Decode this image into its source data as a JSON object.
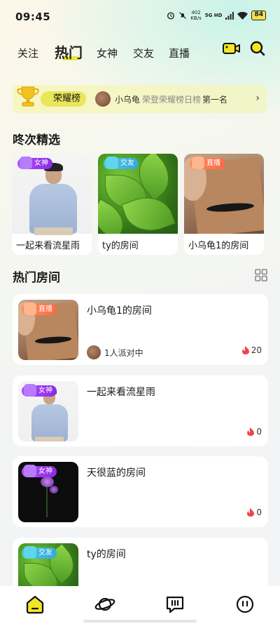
{
  "status_bar": {
    "time": "09:45",
    "speed_value": "402",
    "speed_unit": "KB/s",
    "network": "5G HD",
    "battery": "84"
  },
  "top_nav": {
    "tabs": [
      "关注",
      "热门",
      "女神",
      "交友",
      "直播"
    ],
    "active_index": 1,
    "icons": [
      "video-camera-icon",
      "search-icon"
    ]
  },
  "honor_banner": {
    "label": "荣耀榜",
    "name": "小乌龟",
    "desc": "荣登荣耀榜日榜",
    "rank": "第一名",
    "icon": "trophy-icon"
  },
  "picks": {
    "title": "咚次精选",
    "items": [
      {
        "tag": "女神",
        "tag_type": "goddess",
        "label": "一起来看流星雨",
        "image": "man-portrait"
      },
      {
        "tag": "交友",
        "tag_type": "friend",
        "label": "ty的房间",
        "image": "green-leaves"
      },
      {
        "tag": "直播",
        "tag_type": "live",
        "label": "小乌龟1的房间",
        "image": "book-cover"
      }
    ]
  },
  "hot_rooms": {
    "title": "热门房间",
    "rooms": [
      {
        "title": "小乌龟1的房间",
        "tag": "直播",
        "tag_type": "live",
        "people": "1人派对中",
        "heat": "20",
        "image": "book-cover"
      },
      {
        "title": "一起来看流星雨",
        "tag": "女神",
        "tag_type": "goddess",
        "people": "",
        "heat": "0",
        "image": "man-portrait"
      },
      {
        "title": "天很蓝的房间",
        "tag": "女神",
        "tag_type": "goddess",
        "people": "",
        "heat": "0",
        "image": "dark-flower"
      },
      {
        "title": "ty的房间",
        "tag": "交友",
        "tag_type": "friend",
        "people": "",
        "heat": "",
        "image": "green-leaves"
      }
    ]
  },
  "bottom_nav": {
    "items": [
      "home-icon",
      "planet-icon",
      "message-icon",
      "profile-icon"
    ],
    "active_index": 0
  },
  "colors": {
    "accent_yellow": "#f2e526",
    "goddess_tag": "#9b3ef0",
    "friend_tag": "#3fb7e0",
    "live_tag": "#ff7a4f",
    "heat_red": "#f0434d"
  }
}
